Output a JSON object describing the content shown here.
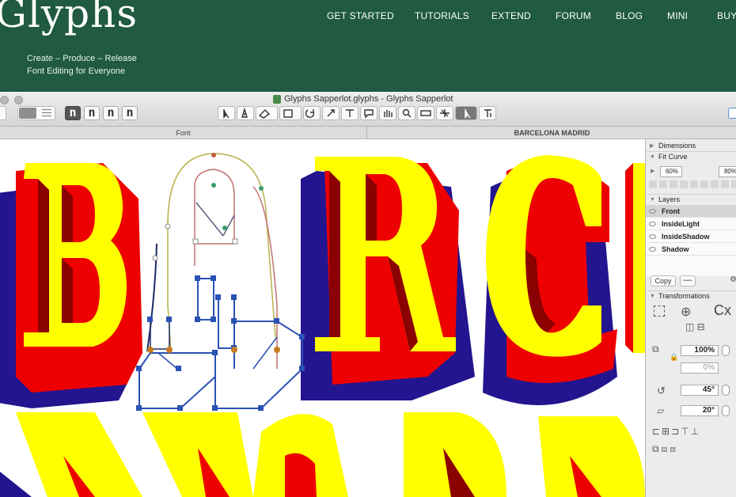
{
  "site": {
    "logo": "Glyphs",
    "tagline_line1": "Create – Produce – Release",
    "tagline_line2": "Font Editing for Everyone",
    "nav": [
      "GET STARTED",
      "TUTORIALS",
      "EXTEND",
      "FORUM",
      "BLOG",
      "MINI",
      "BUY"
    ]
  },
  "window": {
    "title": "Glyphs Sapperlot.glyphs - Glyphs Sapperlot",
    "glyph_buttons": [
      "n",
      "n",
      "n",
      "n"
    ],
    "tabs": [
      "Font",
      "BARCELONA MADRID"
    ]
  },
  "panel": {
    "dimensions_label": "Dimensions",
    "fit_curve_label": "Fit Curve",
    "fit_min": "60%",
    "fit_max": "80%",
    "layers_label": "Layers",
    "layers": [
      "Front",
      "InsideLight",
      "InsideShadow",
      "Shadow"
    ],
    "copy_label": "Copy",
    "transformations_label": "Transformations",
    "cx_label": "Cx",
    "scale_value": "100%",
    "scale2_value": "0%",
    "rotate_value": "45°",
    "slant_value": "20°"
  },
  "colors": {
    "site_bg": "#1f5a41",
    "face": "#ffff00",
    "inline": "#8b0000",
    "red_shadow": "#ee0000",
    "blue_shadow": "#23158f",
    "path_blue": "#2a52b4"
  },
  "icons": [
    "cursor-icon",
    "pen-icon",
    "eraser-icon",
    "rectangle-icon",
    "rotate-icon",
    "scale-icon",
    "text-icon",
    "annotation-icon",
    "hand-icon",
    "zoom-icon",
    "measure-icon",
    "component-icon",
    "select-all-icon",
    "text-tool-icon"
  ]
}
